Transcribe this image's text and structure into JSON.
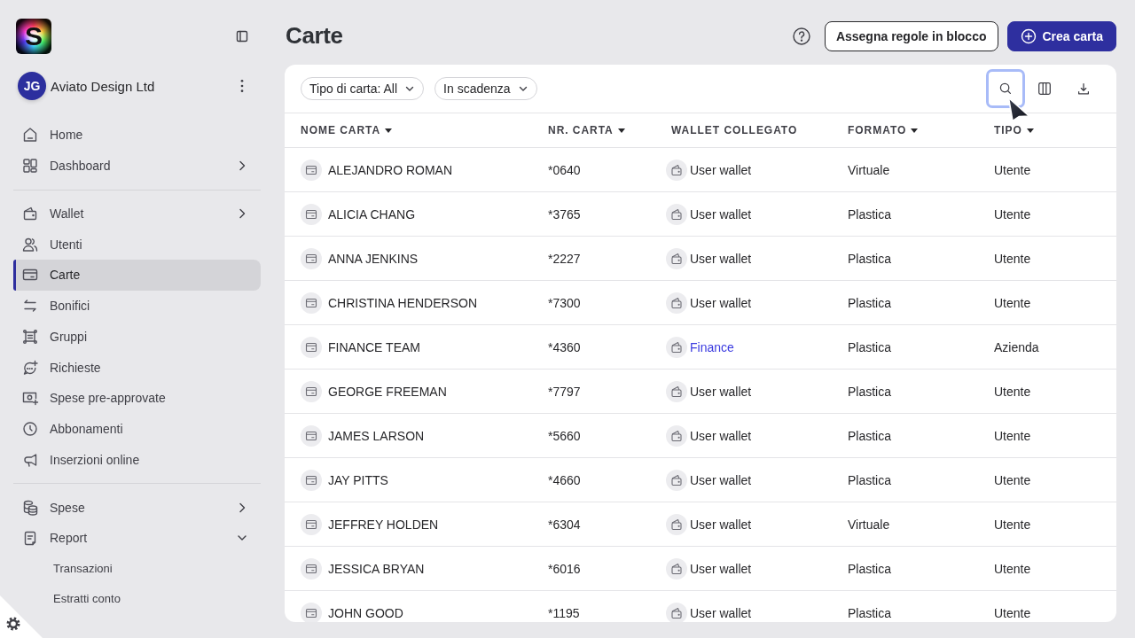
{
  "sidebar": {
    "logo": {
      "letter": "S"
    },
    "account": {
      "initials": "JG",
      "name": "Aviato Design Ltd"
    },
    "sections": [
      {
        "items": [
          {
            "label": "Home",
            "kind": "link",
            "selected": false
          },
          {
            "label": "Dashboard",
            "kind": "group",
            "expanded": false,
            "selected": false
          }
        ]
      },
      {
        "items": [
          {
            "label": "Wallet",
            "kind": "group",
            "expanded": false,
            "selected": false
          },
          {
            "label": "Utenti",
            "kind": "link",
            "selected": false
          },
          {
            "label": "Carte",
            "kind": "link",
            "selected": true
          },
          {
            "label": "Bonifici",
            "kind": "link",
            "selected": false
          },
          {
            "label": "Gruppi",
            "kind": "link",
            "selected": false
          },
          {
            "label": "Richieste",
            "kind": "link",
            "selected": false
          },
          {
            "label": "Spese pre-approvate",
            "kind": "link",
            "selected": false
          },
          {
            "label": "Abbonamenti",
            "kind": "link",
            "selected": false
          },
          {
            "label": "Inserzioni online",
            "kind": "link",
            "selected": false
          }
        ]
      },
      {
        "items": [
          {
            "label": "Spese",
            "kind": "group",
            "expanded": false,
            "selected": false
          },
          {
            "label": "Report",
            "kind": "group",
            "expanded": true,
            "selected": false,
            "children": [
              {
                "label": "Transazioni",
                "selected": false
              },
              {
                "label": "Estratti conto",
                "selected": false
              }
            ]
          }
        ]
      }
    ]
  },
  "header": {
    "title": "Carte",
    "buttons": [
      {
        "label": "Assegna regole in blocco",
        "kind": "secondary"
      },
      {
        "label": "Crea carta",
        "kind": "primary"
      }
    ]
  },
  "toolbar": {
    "filters": [
      {
        "label": "Tipo di carta: All"
      },
      {
        "label": "In scadenza"
      }
    ],
    "tools": [
      {
        "focused": true
      },
      {
        "focused": false
      },
      {
        "focused": false
      }
    ]
  },
  "table": {
    "columns": [
      {
        "label": "NOME CARTA",
        "sortable": true
      },
      {
        "label": "NR. CARTA",
        "sortable": true
      },
      {
        "label": "WALLET COLLEGATO",
        "sortable": false
      },
      {
        "label": "FORMATO",
        "sortable": true
      },
      {
        "label": "TIPO",
        "sortable": true
      }
    ],
    "rows": [
      {
        "name": "ALEJANDRO ROMAN",
        "number": "*0640",
        "wallet": {
          "label": "User wallet",
          "link": false
        },
        "format": "Virtuale",
        "type": "Utente"
      },
      {
        "name": "ALICIA CHANG",
        "number": "*3765",
        "wallet": {
          "label": "User wallet",
          "link": false
        },
        "format": "Plastica",
        "type": "Utente"
      },
      {
        "name": "ANNA JENKINS",
        "number": "*2227",
        "wallet": {
          "label": "User wallet",
          "link": false
        },
        "format": "Plastica",
        "type": "Utente"
      },
      {
        "name": "CHRISTINA HENDERSON",
        "number": "*7300",
        "wallet": {
          "label": "User wallet",
          "link": false
        },
        "format": "Plastica",
        "type": "Utente"
      },
      {
        "name": "FINANCE TEAM",
        "number": "*4360",
        "wallet": {
          "label": "Finance",
          "link": true
        },
        "format": "Plastica",
        "type": "Azienda"
      },
      {
        "name": "GEORGE FREEMAN",
        "number": "*7797",
        "wallet": {
          "label": "User wallet",
          "link": false
        },
        "format": "Plastica",
        "type": "Utente"
      },
      {
        "name": "JAMES LARSON",
        "number": "*5660",
        "wallet": {
          "label": "User wallet",
          "link": false
        },
        "format": "Plastica",
        "type": "Utente"
      },
      {
        "name": "JAY PITTS",
        "number": "*4660",
        "wallet": {
          "label": "User wallet",
          "link": false
        },
        "format": "Plastica",
        "type": "Utente"
      },
      {
        "name": "JEFFREY HOLDEN",
        "number": "*6304",
        "wallet": {
          "label": "User wallet",
          "link": false
        },
        "format": "Virtuale",
        "type": "Utente"
      },
      {
        "name": "JESSICA BRYAN",
        "number": "*6016",
        "wallet": {
          "label": "User wallet",
          "link": false
        },
        "format": "Plastica",
        "type": "Utente"
      },
      {
        "name": "JOHN GOOD",
        "number": "*1195",
        "wallet": {
          "label": "User wallet",
          "link": false
        },
        "format": "Plastica",
        "type": "Utente"
      }
    ]
  }
}
